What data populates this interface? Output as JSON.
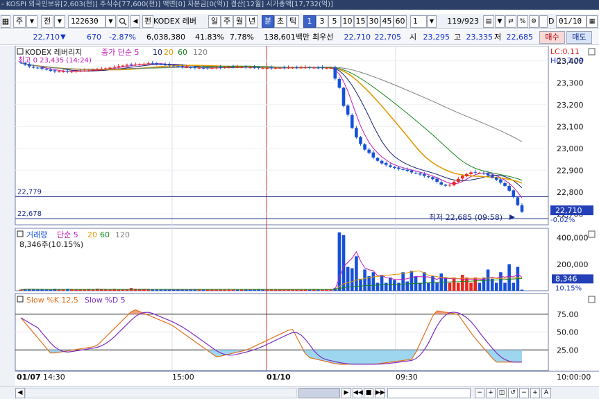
{
  "window": {
    "title": "- KOSPI 외국인보유[2,603(천)] 주식수[77,600(천)] 액면[0] 자본금[0(억)] 결산[12월] 시가총액[17,732(억)]"
  },
  "toolbar": {
    "market": "주",
    "period_type": "전",
    "code": "122630",
    "search_icon": "search-icon",
    "fund_label": "펀",
    "name": "KODEX 레버",
    "daily": "일",
    "weekly": "주",
    "monthly": "월",
    "yearly": "년",
    "minute": "분",
    "second": "초",
    "tick": "틱",
    "intervals": [
      "1",
      "3",
      "5",
      "10",
      "15",
      "30",
      "45",
      "60"
    ],
    "interval_selected": "1",
    "count": "1",
    "range": "119/923",
    "d_label": "D",
    "date": "01/10"
  },
  "quote": {
    "price": "22,710",
    "arrow": "▼",
    "change": "670",
    "change_pct": "-2.87%",
    "volume": "6,038,380",
    "vol_ratio": "41.83%",
    "turnover": "7.78%",
    "amount": "138,601백만",
    "best_ask_label": "최우선",
    "best_ask": "22,710",
    "best_bid": "22,705",
    "open_label": "시",
    "open": "23,295",
    "high_label": "고",
    "high": "23,335",
    "low_label": "저",
    "low": "22,685",
    "buy_button": "매수",
    "sell_button": "매도"
  },
  "chart": {
    "series_label": "KODEX 레버리지",
    "ma_label": "종가 단순",
    "ma_periods": [
      "5",
      "10",
      "20",
      "60",
      "120"
    ],
    "high_label": "최고 0 23,435 (14:24)",
    "lc_label": "LC:0.11",
    "hc_label": "HC:-3.09",
    "price_ticks": [
      "23,400",
      "23,300",
      "23,200",
      "23,100",
      "23,000",
      "22,900",
      "22,800",
      "22,700"
    ],
    "level_1": "22,779",
    "level_2": "22,678",
    "low_annotation": "최저 22,685 (09:58)",
    "current_price_tag": "22,710",
    "current_pct_tag": "-0.02%",
    "volume_label": "거래량",
    "vol_ma_label": "단순",
    "vol_ma_periods": [
      "5",
      "20",
      "60",
      "120"
    ],
    "volume_value": "8,346주(10.15%)",
    "volume_ticks": [
      "400,000",
      "200,000"
    ],
    "volume_tag": "8,346",
    "volume_pct_tag": "10.15%",
    "stoch_label_k": "Slow %K 12,5",
    "stoch_label_d": "Slow %D 5",
    "stoch_ticks": [
      "75.00",
      "50.00",
      "25.00"
    ],
    "time_labels": [
      "01/07",
      "14:30",
      "15:00",
      "01/10",
      "09:30"
    ],
    "right_time": "10:00:00"
  },
  "chart_data": {
    "type": "candlestick",
    "y_range": [
      22650,
      23450
    ],
    "close": [
      23390,
      23383,
      23375,
      23369,
      23368,
      23364,
      23360,
      23355,
      23352,
      23352,
      23352,
      23351,
      23351,
      23354,
      23356,
      23356,
      23357,
      23359,
      23360,
      23363,
      23366,
      23369,
      23372,
      23376,
      23378,
      23382,
      23383,
      23383,
      23385,
      23387,
      23389,
      23388,
      23387,
      23384,
      23382,
      23380,
      23377,
      23375,
      23373,
      23371,
      23369,
      23368,
      23368,
      23367,
      23367,
      23368,
      23369,
      23370,
      23371,
      23372,
      23373,
      23372,
      23372,
      23371,
      23370,
      23369,
      23368,
      23367,
      23367,
      23367,
      23368,
      23368,
      23369,
      23369,
      23370,
      23370,
      23370,
      23370,
      23369,
      23369,
      23368,
      23368,
      23368,
      23368,
      23319,
      23277,
      23194,
      23154,
      23093,
      23050,
      23020,
      22994,
      22979,
      22958,
      22943,
      22931,
      22924,
      22915,
      22910,
      22906,
      22902,
      22897,
      22890,
      22885,
      22880,
      22874,
      22868,
      22859,
      22847,
      22834,
      22829,
      22833,
      22847,
      22860,
      22874,
      22882,
      22890,
      22890,
      22888,
      22885,
      22877,
      22866,
      22856,
      22843,
      22828,
      22806,
      22778,
      22740,
      22710
    ],
    "volume": [
      8000,
      14000,
      14000,
      10000,
      8000,
      8000,
      10000,
      8000,
      15000,
      9000,
      9000,
      15000,
      8000,
      9000,
      8000,
      10000,
      14000,
      9000,
      16000,
      8000,
      8000,
      8000,
      15000,
      8000,
      10000,
      9000,
      20000,
      10000,
      9000,
      11000,
      11000,
      10000,
      11000,
      9000,
      9000,
      8000,
      10000,
      8000,
      12000,
      9000,
      9000,
      8000,
      11000,
      9000,
      10000,
      11000,
      10000,
      11000,
      11000,
      11000,
      8000,
      12000,
      10000,
      8000,
      10000,
      9000,
      14000,
      8000,
      9000,
      13000,
      8000,
      8000,
      10000,
      10000,
      9000,
      11000,
      13000,
      10000,
      10000,
      11000,
      8000,
      8000,
      10000,
      10000,
      20000,
      440000,
      420000,
      180000,
      170000,
      260000,
      90000,
      160000,
      110000,
      140000,
      60000,
      120000,
      60000,
      100000,
      80000,
      60000,
      140000,
      70000,
      150000,
      110000,
      60000,
      140000,
      60000,
      110000,
      60000,
      130000,
      100000,
      60000,
      100000,
      60000,
      120000,
      100000,
      60000,
      100000,
      60000,
      100000,
      160000,
      90000,
      60000,
      140000,
      60000,
      200000,
      60000,
      180000,
      8346
    ],
    "stoch_k_range": [
      0,
      100
    ]
  }
}
